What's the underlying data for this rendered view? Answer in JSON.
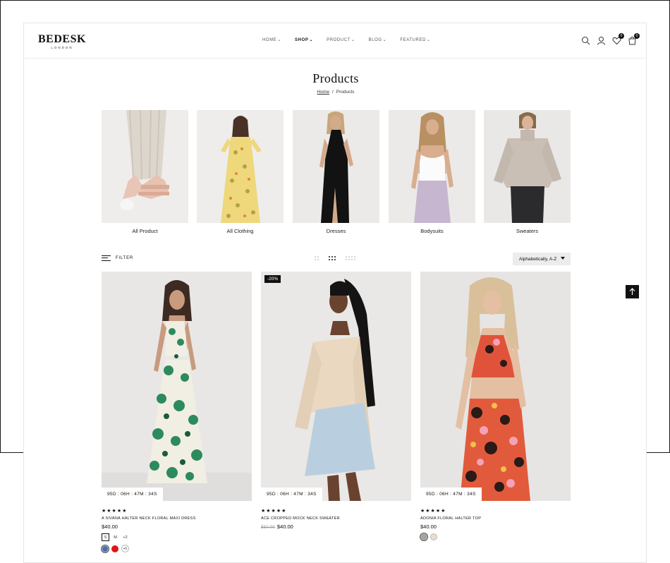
{
  "header": {
    "logo_main": "BEDESK",
    "logo_sub": "LONDON",
    "nav": [
      "HOME",
      "SHOP",
      "PRODUCT",
      "BLOG",
      "FEATURED"
    ],
    "wishlist_count": "0",
    "cart_count": "0"
  },
  "page": {
    "title": "Products",
    "breadcrumb_home": "Home",
    "breadcrumb_sep": "/",
    "breadcrumb_current": "Products"
  },
  "categories": [
    "All Product",
    "All Clothing",
    "Dresses",
    "Bodysuits",
    "Sweaters"
  ],
  "toolbar": {
    "filter_label": "FILTER",
    "sort_value": "Alphabetically, A-Z"
  },
  "products": [
    {
      "name": "A SIVANA HALTER NECK FLORAL MAXI DRESS",
      "price": "$40.00",
      "old_price": "",
      "badge": "",
      "countdown": "95D : 06H : 47M : 34S",
      "rating": "★★★★★",
      "sizes": [
        "S",
        "M",
        "+2"
      ],
      "swatch_colors": [
        "#4a6fb0",
        "#e01515"
      ],
      "more_swatches": "+1"
    },
    {
      "name": "ACE CROPPED MOCK NECK SWEATER",
      "price": "$40.00",
      "old_price": "$50.00",
      "badge": "-20%",
      "countdown": "95D : 06H : 47M : 34S",
      "rating": "★★★★★",
      "sizes": [],
      "swatch_colors": [],
      "more_swatches": ""
    },
    {
      "name": "ADONIA FLORAL HALTER TOP",
      "price": "$40.00",
      "old_price": "",
      "badge": "",
      "countdown": "95D : 06H : 47M : 34S",
      "rating": "★★★★★",
      "sizes": [],
      "swatch_colors": [
        "#a8a39a",
        "#e8ddd2"
      ],
      "more_swatches": ""
    }
  ]
}
